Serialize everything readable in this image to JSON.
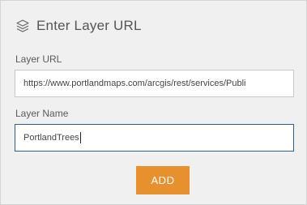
{
  "header": {
    "title": "Enter Layer URL",
    "icon": "layers-icon"
  },
  "form": {
    "url_label": "Layer URL",
    "url_value": "https://www.portlandmaps.com/arcgis/rest/services/Publi",
    "name_label": "Layer Name",
    "name_value": "PortlandTrees"
  },
  "actions": {
    "add_label": "ADD"
  },
  "colors": {
    "panel_bg": "#f0f0f0",
    "accent": "#e6902e",
    "focus_border": "#2f5f8c"
  }
}
